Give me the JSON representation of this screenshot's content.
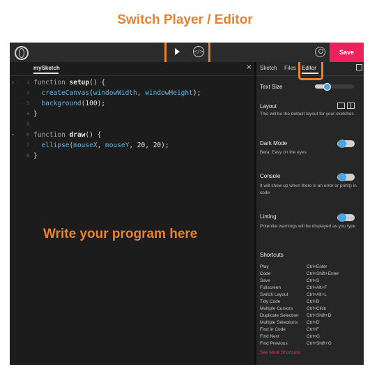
{
  "annotations": {
    "title": "Switch Player / Editor",
    "program_hint": "Write your program here"
  },
  "topbar": {
    "save_label": "Save"
  },
  "editor": {
    "file_tab": "mySketch",
    "close_glyph": "×",
    "line_numbers": [
      "1",
      "2",
      "3",
      "4",
      "5",
      "6",
      "7",
      "8"
    ]
  },
  "panel": {
    "tabs": {
      "sketch": "Sketch",
      "files": "Files",
      "editor": "Editor"
    },
    "text_size": {
      "label": "Text Size",
      "level_fraction": 0.28
    },
    "layout": {
      "label": "Layout",
      "desc": "This will be the default layout for your sketches"
    },
    "dark_mode": {
      "label": "Dark Mode",
      "desc": "Beta: Easy on the eyes",
      "enabled": true
    },
    "console": {
      "label": "Console",
      "desc": "It will show up when there is an error or print() in code",
      "enabled": true
    },
    "linting": {
      "label": "Linting",
      "desc": "Potential warnings will be displayed as you type",
      "enabled": true
    },
    "shortcuts_title": "Shortcuts",
    "shortcuts": [
      {
        "action": "Play",
        "key": "Ctrl+Enter"
      },
      {
        "action": "Code",
        "key": "Ctrl+Shift+Enter"
      },
      {
        "action": "Save",
        "key": "Ctrl+S"
      },
      {
        "action": "Fullscreen",
        "key": "Ctrl+Alt+F"
      },
      {
        "action": "Switch Layout",
        "key": "Ctrl+Alt+L"
      },
      {
        "action": "Tidy Code",
        "key": "Ctrl+B"
      },
      {
        "action": "Multiple Cursors",
        "key": "Ctrl+Click"
      },
      {
        "action": "Duplicate Selection",
        "key": "Ctrl+Shift+D"
      },
      {
        "action": "Multiple Selections",
        "key": "Ctrl+D"
      },
      {
        "action": "Find in Code",
        "key": "Ctrl+F"
      },
      {
        "action": "Find Next",
        "key": "Ctrl+G"
      },
      {
        "action": "Find Previous",
        "key": "Ctrl+Shift+G"
      }
    ],
    "see_more": "See More Shortcuts"
  },
  "colors": {
    "accent_annotation": "#e8822f",
    "save_button": "#ed225d",
    "toggle_knob": "#4aa5e0"
  },
  "icons": [
    "p5-logo-icon",
    "play-icon",
    "code-icon",
    "user-icon",
    "close-icon",
    "expand-icon",
    "layout-icon",
    "fold-arrow-icon"
  ]
}
